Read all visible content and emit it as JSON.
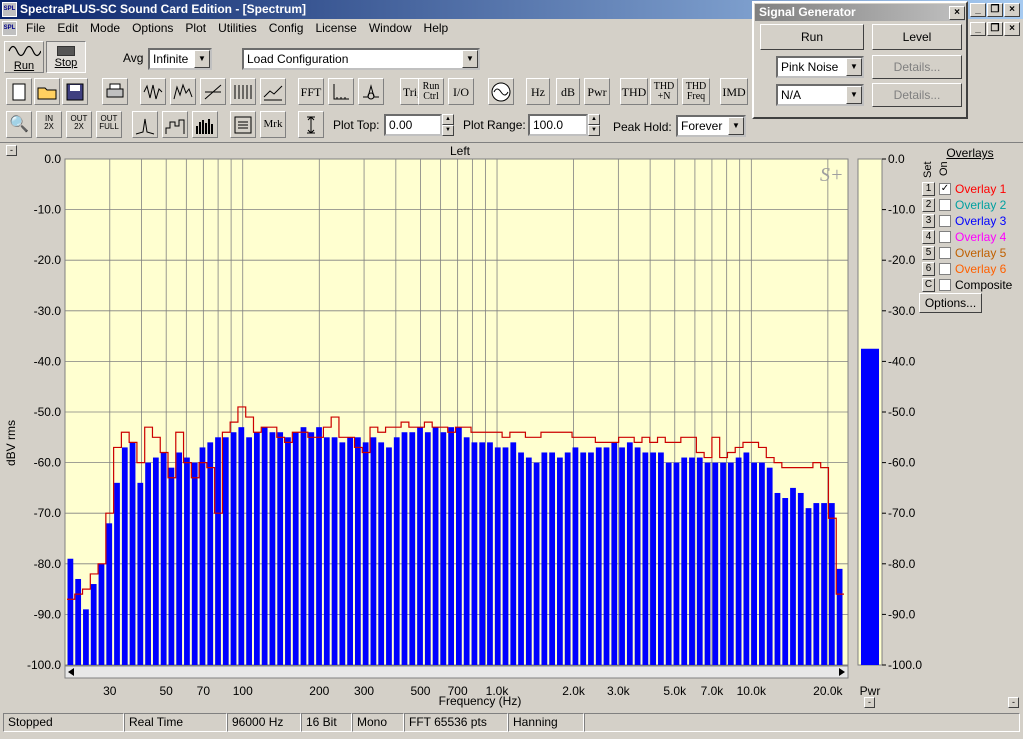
{
  "window": {
    "title": "SpectraPLUS-SC Sound Card Edition - [Spectrum]"
  },
  "menu": [
    "File",
    "Edit",
    "Mode",
    "Options",
    "Plot",
    "Utilities",
    "Config",
    "License",
    "Window",
    "Help"
  ],
  "toolbar1": {
    "run_label": "Run",
    "stop_label": "Stop",
    "avg_label": "Avg",
    "avg_value": "Infinite",
    "config_value": "Load Configuration"
  },
  "toolbar2": [
    "FFT",
    "Trig",
    "Run\nCtrl",
    "I/O",
    "Hz",
    "dB",
    "Pwr",
    "THD",
    "THD\n+N",
    "THD\nFreq",
    "IMD"
  ],
  "toolbar3": {
    "mrk_label": "Mrk",
    "plot_top_label": "Plot Top:",
    "plot_top_value": "0.00",
    "plot_range_label": "Plot Range:",
    "plot_range_value": "100.0",
    "peak_hold_label": "Peak Hold:",
    "peak_hold_value": "Forever",
    "zoom_in": "IN\n2X",
    "zoom_out": "OUT\n2X",
    "zoom_full": "OUT\nFULL"
  },
  "signal_generator": {
    "title": "Signal Generator",
    "run_label": "Run",
    "level_label": "Level",
    "noise_value": "Pink Noise",
    "na_value": "N/A",
    "details1": "Details...",
    "details2": "Details..."
  },
  "plot": {
    "channel": "Left",
    "ylabel": "dBV rms",
    "xlabel": "Frequency (Hz)",
    "pwr_label": "Pwr",
    "logo": "S+"
  },
  "overlays": {
    "title": "Overlays",
    "set_label": "Set",
    "on_label": "On",
    "options_label": "Options...",
    "items": [
      {
        "set": "1",
        "name": "Overlay 1",
        "checked": true,
        "color": "#ff0000"
      },
      {
        "set": "2",
        "name": "Overlay 2",
        "checked": false,
        "color": "#00a0a0"
      },
      {
        "set": "3",
        "name": "Overlay 3",
        "checked": false,
        "color": "#0000ff"
      },
      {
        "set": "4",
        "name": "Overlay 4",
        "checked": false,
        "color": "#ff00ff"
      },
      {
        "set": "5",
        "name": "Overlay 5",
        "checked": false,
        "color": "#c06000"
      },
      {
        "set": "6",
        "name": "Overlay 6",
        "checked": false,
        "color": "#ff6000"
      },
      {
        "set": "C",
        "name": "Composite",
        "checked": false,
        "color": "#000000"
      }
    ]
  },
  "status": [
    "Stopped",
    "Real Time",
    "96000 Hz",
    "16 Bit",
    "Mono",
    "FFT 65536 pts",
    "Hanning"
  ],
  "chart_data": {
    "type": "bar",
    "title": "Left",
    "xlabel": "Frequency (Hz)",
    "ylabel": "dBV rms",
    "xscale": "log",
    "xlim": [
      20,
      24000
    ],
    "ylim": [
      -100,
      0
    ],
    "ytick_labels": [
      "0.0",
      "-10.0",
      "-20.0",
      "-30.0",
      "-40.0",
      "-50.0",
      "-60.0",
      "-70.0",
      "-80.0",
      "-90.0",
      "-100.0"
    ],
    "xtick_labels": [
      "30",
      "50",
      "70",
      "100",
      "200",
      "300",
      "500",
      "700",
      "1.0k",
      "2.0k",
      "3.0k",
      "5.0k",
      "7.0k",
      "10.0k",
      "20.0k"
    ],
    "xtick_values": [
      30,
      50,
      70,
      100,
      200,
      300,
      500,
      700,
      1000,
      2000,
      3000,
      5000,
      7000,
      10000,
      20000
    ],
    "bar_color": "#0000ff",
    "plot_bg": "#ffffd0",
    "series": [
      {
        "name": "Left",
        "values": [
          -79,
          -83,
          -89,
          -84,
          -80,
          -72,
          -64,
          -57,
          -56,
          -64,
          -60,
          -59,
          -58,
          -61,
          -58,
          -59,
          -60,
          -57,
          -56,
          -55,
          -55,
          -54,
          -53,
          -55,
          -54,
          -53,
          -54,
          -54,
          -55,
          -54,
          -53,
          -54,
          -53,
          -55,
          -55,
          -56,
          -55,
          -55,
          -56,
          -55,
          -56,
          -57,
          -55,
          -54,
          -54,
          -53,
          -54,
          -53,
          -54,
          -53,
          -53,
          -55,
          -56,
          -56,
          -56,
          -57,
          -57,
          -56,
          -58,
          -59,
          -60,
          -58,
          -58,
          -59,
          -58,
          -57,
          -58,
          -58,
          -57,
          -57,
          -56,
          -57,
          -56,
          -57,
          -58,
          -58,
          -58,
          -60,
          -60,
          -59,
          -59,
          -59,
          -60,
          -60,
          -60,
          -60,
          -59,
          -58,
          -60,
          -60,
          -61,
          -66,
          -67,
          -65,
          -66,
          -69,
          -68,
          -68,
          -68,
          -81
        ]
      },
      {
        "name": "Pwr",
        "values": [
          -37.5
        ]
      }
    ],
    "overlay": {
      "name": "Overlay 1",
      "color": "#cc0000",
      "values": [
        -87,
        -86,
        -85,
        -82,
        -80,
        -70,
        -57,
        -54,
        -56,
        -60,
        -53,
        -55,
        -58,
        -63,
        -54,
        -60,
        -63,
        -60,
        -61,
        -70,
        -54,
        -52,
        -49,
        -51,
        -54,
        -53,
        -53,
        -55,
        -56,
        -54,
        -54,
        -55,
        -55,
        -53,
        -51,
        -55,
        -55,
        -57,
        -58,
        -53,
        -54,
        -53,
        -53,
        -52,
        -53,
        -53,
        -52,
        -53,
        -53,
        -54,
        -53,
        -53,
        -54,
        -54,
        -54,
        -54,
        -55,
        -54,
        -54,
        -55,
        -55,
        -54,
        -54,
        -54,
        -54,
        -55,
        -55,
        -55,
        -56,
        -56,
        -56,
        -55,
        -55,
        -56,
        -55,
        -56,
        -55,
        -56,
        -56,
        -55,
        -55,
        -58,
        -59,
        -55,
        -59,
        -58,
        -57,
        -56,
        -56,
        -57,
        -59,
        -60,
        -61,
        -61,
        -61,
        -61,
        -60,
        -61,
        -71,
        -86
      ]
    }
  }
}
